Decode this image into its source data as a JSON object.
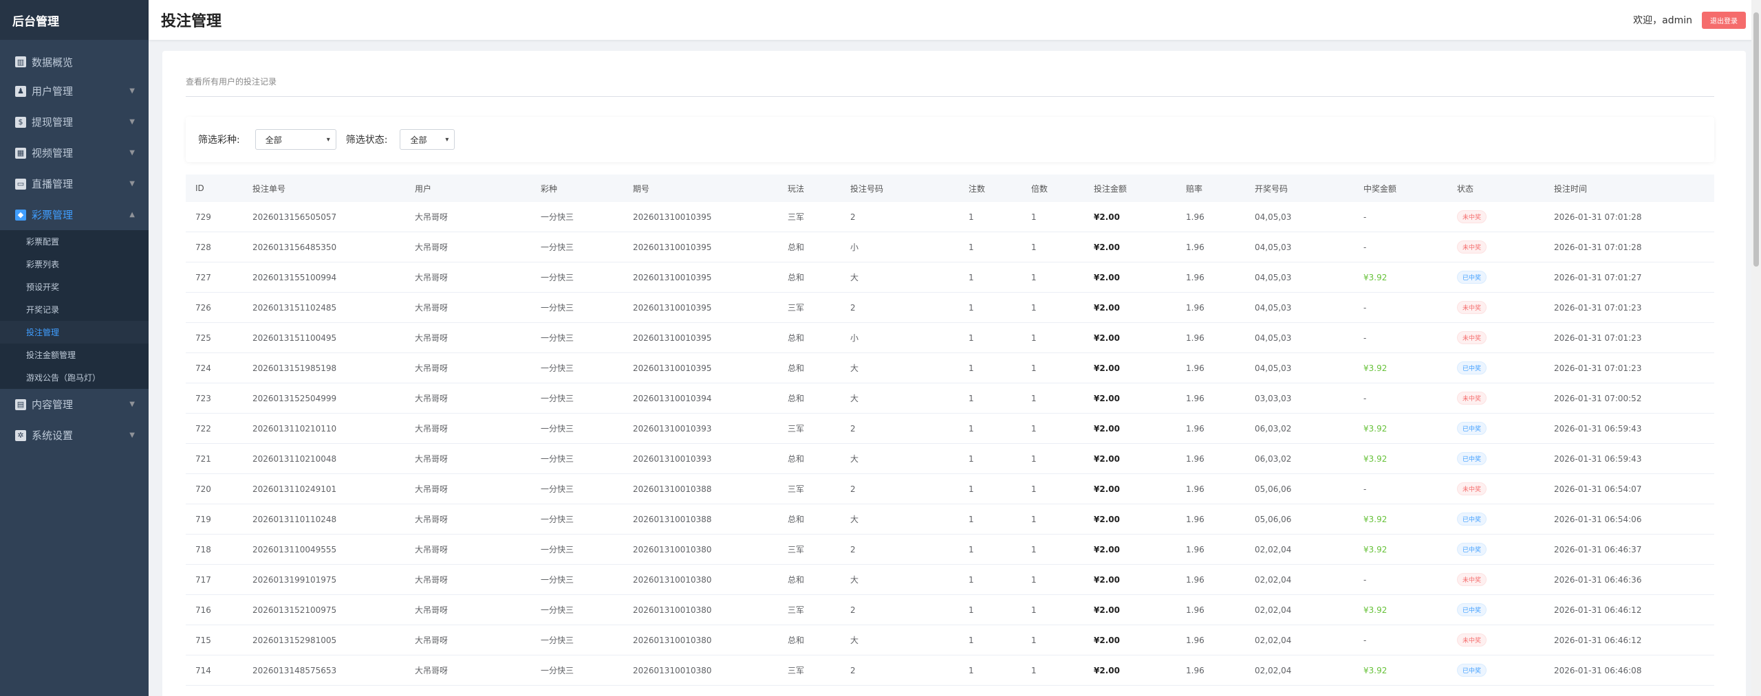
{
  "sidebar": {
    "title": "后台管理",
    "items": [
      {
        "label": "数据概览",
        "icon": "chart-icon",
        "glyph": "▥"
      },
      {
        "label": "用户管理",
        "icon": "user-icon",
        "glyph": "♟"
      },
      {
        "label": "提现管理",
        "icon": "money-bag-icon",
        "glyph": "$"
      },
      {
        "label": "视频管理",
        "icon": "video-icon",
        "glyph": "▦"
      },
      {
        "label": "直播管理",
        "icon": "tv-icon",
        "glyph": "▭"
      },
      {
        "label": "彩票管理",
        "icon": "lottery-icon",
        "glyph": "◆"
      },
      {
        "label": "内容管理",
        "icon": "document-icon",
        "glyph": "▤"
      },
      {
        "label": "系统设置",
        "icon": "gear-icon",
        "glyph": "✲"
      }
    ],
    "submenu": [
      "彩票配置",
      "彩票列表",
      "预设开奖",
      "开奖记录",
      "投注管理",
      "投注金额管理",
      "游戏公告（跑马灯）"
    ]
  },
  "header": {
    "title": "投注管理",
    "welcome": "欢迎，admin",
    "logout": "退出登录"
  },
  "main": {
    "description": "查看所有用户的投注记录",
    "filter": {
      "lottery_label": "筛选彩种:",
      "lottery_value": "全部",
      "status_label": "筛选状态:",
      "status_value": "全部"
    }
  },
  "table": {
    "columns": [
      "ID",
      "投注单号",
      "用户",
      "彩种",
      "期号",
      "玩法",
      "投注号码",
      "注数",
      "倍数",
      "投注金额",
      "赔率",
      "开奖号码",
      "中奖金额",
      "状态",
      "投注时间"
    ],
    "rows": [
      [
        "729",
        "2026013156505057",
        "大吊哥呀",
        "一分快三",
        "202601310010395",
        "三军",
        "2",
        "1",
        "1",
        "¥2.00",
        "1.96",
        "04,05,03",
        "-",
        "未中奖",
        "2026-01-31 07:01:28"
      ],
      [
        "728",
        "2026013156485350",
        "大吊哥呀",
        "一分快三",
        "202601310010395",
        "总和",
        "小",
        "1",
        "1",
        "¥2.00",
        "1.96",
        "04,05,03",
        "-",
        "未中奖",
        "2026-01-31 07:01:28"
      ],
      [
        "727",
        "2026013155100994",
        "大吊哥呀",
        "一分快三",
        "202601310010395",
        "总和",
        "大",
        "1",
        "1",
        "¥2.00",
        "1.96",
        "04,05,03",
        "¥3.92",
        "已中奖",
        "2026-01-31 07:01:27"
      ],
      [
        "726",
        "2026013151102485",
        "大吊哥呀",
        "一分快三",
        "202601310010395",
        "三军",
        "2",
        "1",
        "1",
        "¥2.00",
        "1.96",
        "04,05,03",
        "-",
        "未中奖",
        "2026-01-31 07:01:23"
      ],
      [
        "725",
        "2026013151100495",
        "大吊哥呀",
        "一分快三",
        "202601310010395",
        "总和",
        "小",
        "1",
        "1",
        "¥2.00",
        "1.96",
        "04,05,03",
        "-",
        "未中奖",
        "2026-01-31 07:01:23"
      ],
      [
        "724",
        "2026013151985198",
        "大吊哥呀",
        "一分快三",
        "202601310010395",
        "总和",
        "大",
        "1",
        "1",
        "¥2.00",
        "1.96",
        "04,05,03",
        "¥3.92",
        "已中奖",
        "2026-01-31 07:01:23"
      ],
      [
        "723",
        "2026013152504999",
        "大吊哥呀",
        "一分快三",
        "202601310010394",
        "总和",
        "大",
        "1",
        "1",
        "¥2.00",
        "1.96",
        "03,03,03",
        "-",
        "未中奖",
        "2026-01-31 07:00:52"
      ],
      [
        "722",
        "2026013110210110",
        "大吊哥呀",
        "一分快三",
        "202601310010393",
        "三军",
        "2",
        "1",
        "1",
        "¥2.00",
        "1.96",
        "06,03,02",
        "¥3.92",
        "已中奖",
        "2026-01-31 06:59:43"
      ],
      [
        "721",
        "2026013110210048",
        "大吊哥呀",
        "一分快三",
        "202601310010393",
        "总和",
        "大",
        "1",
        "1",
        "¥2.00",
        "1.96",
        "06,03,02",
        "¥3.92",
        "已中奖",
        "2026-01-31 06:59:43"
      ],
      [
        "720",
        "2026013110249101",
        "大吊哥呀",
        "一分快三",
        "202601310010388",
        "三军",
        "2",
        "1",
        "1",
        "¥2.00",
        "1.96",
        "05,06,06",
        "-",
        "未中奖",
        "2026-01-31 06:54:07"
      ],
      [
        "719",
        "2026013110110248",
        "大吊哥呀",
        "一分快三",
        "202601310010388",
        "总和",
        "大",
        "1",
        "1",
        "¥2.00",
        "1.96",
        "05,06,06",
        "¥3.92",
        "已中奖",
        "2026-01-31 06:54:06"
      ],
      [
        "718",
        "2026013110049555",
        "大吊哥呀",
        "一分快三",
        "202601310010380",
        "三军",
        "2",
        "1",
        "1",
        "¥2.00",
        "1.96",
        "02,02,04",
        "¥3.92",
        "已中奖",
        "2026-01-31 06:46:37"
      ],
      [
        "717",
        "2026013199101975",
        "大吊哥呀",
        "一分快三",
        "202601310010380",
        "总和",
        "大",
        "1",
        "1",
        "¥2.00",
        "1.96",
        "02,02,04",
        "-",
        "未中奖",
        "2026-01-31 06:46:36"
      ],
      [
        "716",
        "2026013152100975",
        "大吊哥呀",
        "一分快三",
        "202601310010380",
        "三军",
        "2",
        "1",
        "1",
        "¥2.00",
        "1.96",
        "02,02,04",
        "¥3.92",
        "已中奖",
        "2026-01-31 06:46:12"
      ],
      [
        "715",
        "2026013152981005",
        "大吊哥呀",
        "一分快三",
        "202601310010380",
        "总和",
        "大",
        "1",
        "1",
        "¥2.00",
        "1.96",
        "02,02,04",
        "-",
        "未中奖",
        "2026-01-31 06:46:12"
      ],
      [
        "714",
        "2026013148575653",
        "大吊哥呀",
        "一分快三",
        "202601310010380",
        "三军",
        "2",
        "1",
        "1",
        "¥2.00",
        "1.96",
        "02,02,04",
        "¥3.92",
        "已中奖",
        "2026-01-31 06:46:08"
      ]
    ]
  }
}
